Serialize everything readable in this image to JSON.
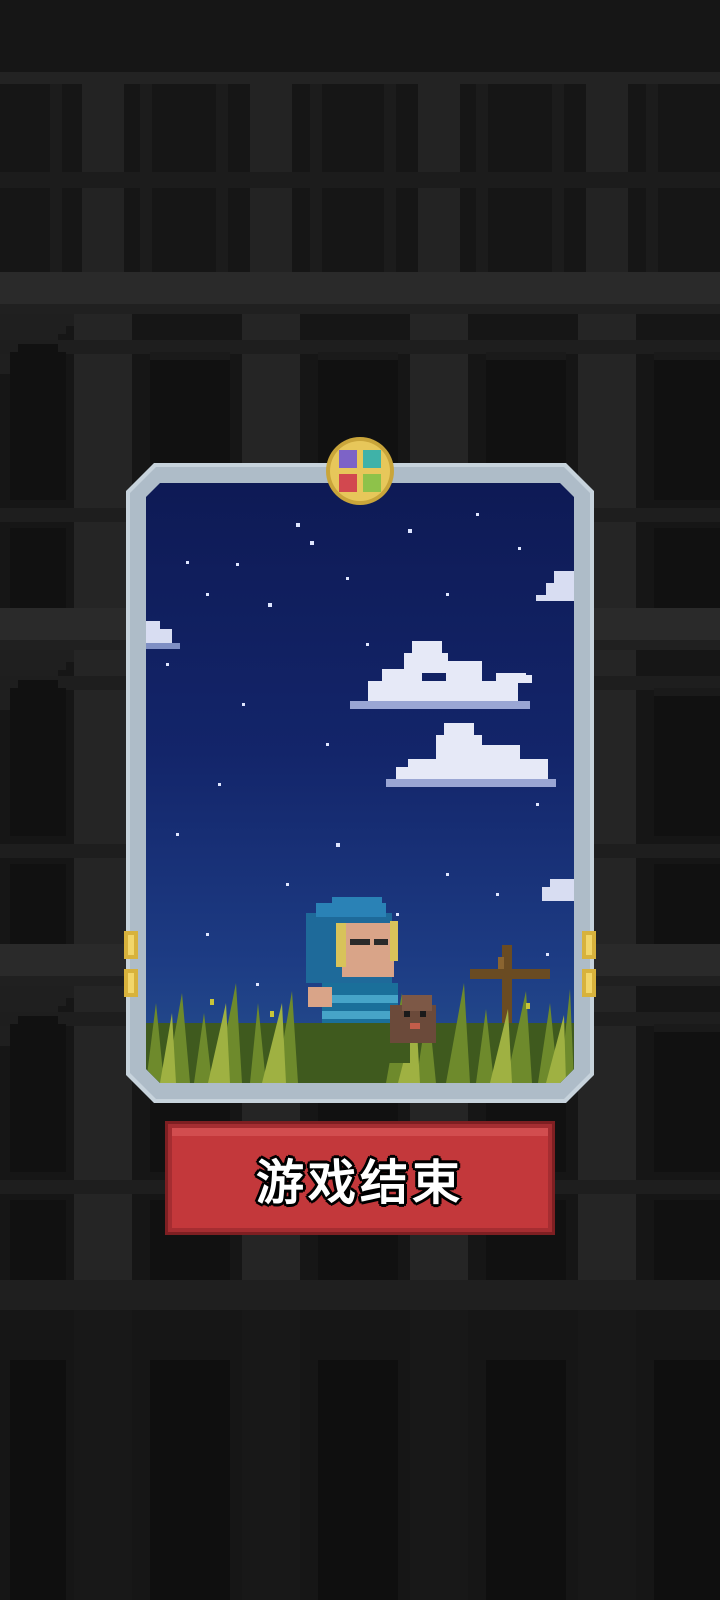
{
  "screen": "game-over",
  "colors": {
    "background": "#151515",
    "button": "#c3383b",
    "card_frame": "#c7d3dc",
    "sky_top": "#0e1a55",
    "sky_bottom": "#26508f"
  },
  "card": {
    "emblem_icon": "four-suit-emblem-icon",
    "scene_icons": [
      "stars",
      "clouds",
      "hooded-hero-icon",
      "dog-companion-icon",
      "grave-cross-icon",
      "grass"
    ]
  },
  "button": {
    "label": "游戏结束"
  }
}
